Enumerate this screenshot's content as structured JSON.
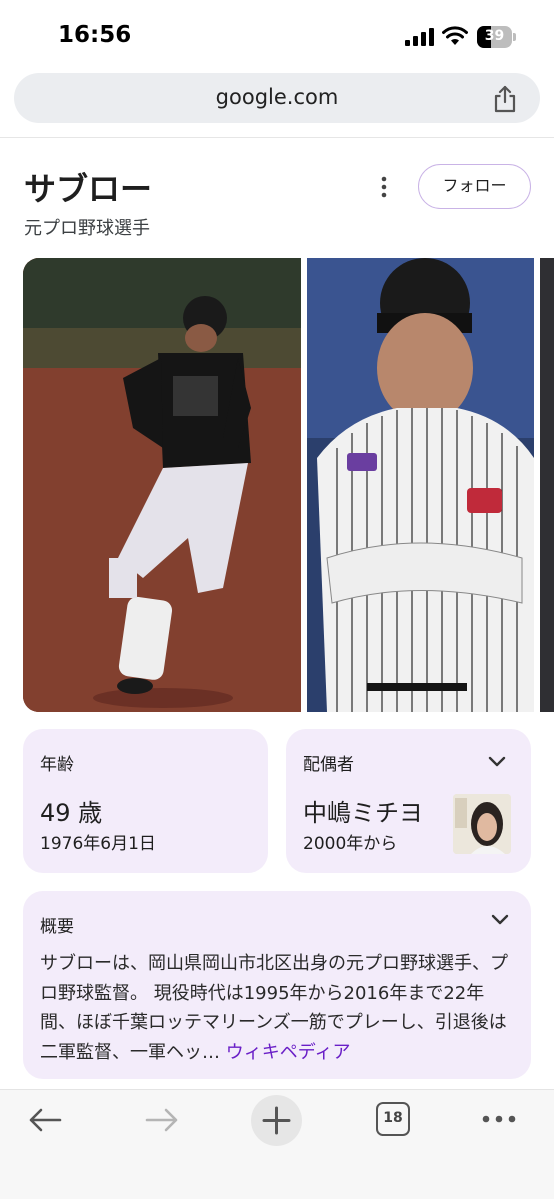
{
  "status_bar": {
    "time": "16:56",
    "battery_level": "39",
    "battery_fraction": 0.39,
    "icons": [
      "signal-icon",
      "wifi-icon",
      "battery-icon"
    ]
  },
  "browser": {
    "url": "google.com",
    "share_icon": "share-icon"
  },
  "entity": {
    "title": "サブロー",
    "subtitle": "元プロ野球選手",
    "follow_label": "フォロー",
    "more_icon": "more-vertical-icon"
  },
  "facts": {
    "age": {
      "label": "年齢",
      "value": "49 歳",
      "sub": "1976年6月1日"
    },
    "spouse": {
      "label": "配偶者",
      "value": "中嶋ミチヨ",
      "sub": "2000年から"
    }
  },
  "overview": {
    "label": "概要",
    "text": "サブローは、岡山県岡山市北区出身の元プロ野球選手、プロ野球監督。 現役時代は1995年から2016年まで22年間、ほぼ千葉ロッテマリーンズ一筋でプレーし、引退後は二軍監督、一軍ヘッ…",
    "link": "ウィキペディア"
  },
  "toolbar": {
    "tab_count": "18",
    "icons": [
      "back-arrow-icon",
      "forward-arrow-icon",
      "plus-icon",
      "tabs-icon",
      "more-horizontal-icon"
    ]
  },
  "colors": {
    "card_bg": "#f3ecfa",
    "link": "#6a1fc7",
    "follow_border": "#c9b3e6",
    "url_bar_bg": "#ebedf0"
  }
}
